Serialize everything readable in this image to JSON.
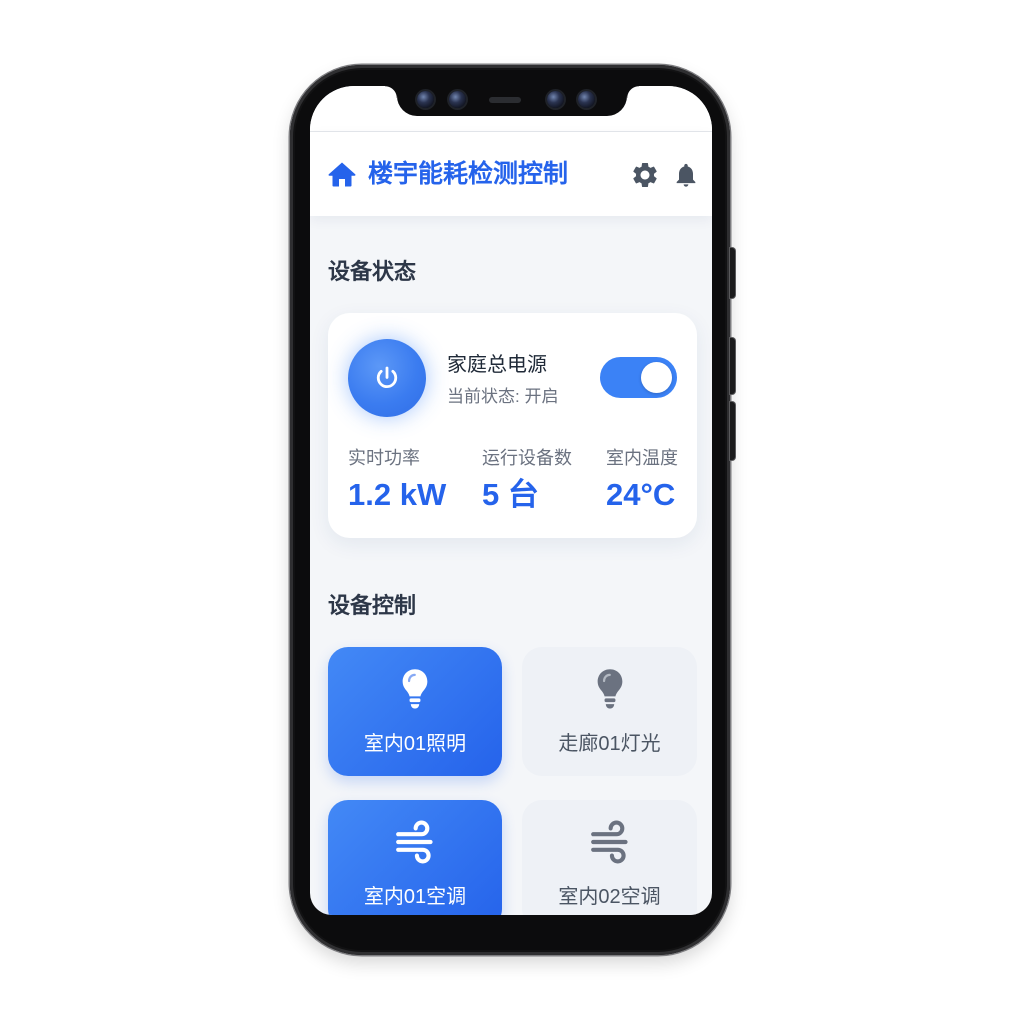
{
  "header": {
    "title": "楼宇能耗检测控制",
    "icons": {
      "brand": "home-icon",
      "settings": "gear-icon",
      "notifications": "bell-icon"
    }
  },
  "device_status": {
    "section_title": "设备状态",
    "main_power": {
      "name": "家庭总电源",
      "status_text": "当前状态: 开启",
      "is_on": true,
      "icon": "power-icon"
    },
    "stats": [
      {
        "label": "实时功率",
        "value": "1.2 kW"
      },
      {
        "label": "运行设备数",
        "value": "5 台"
      },
      {
        "label": "室内温度",
        "value": "24°C"
      }
    ]
  },
  "device_control": {
    "section_title": "设备控制",
    "devices": [
      {
        "name": "室内01照明",
        "icon": "lightbulb-icon",
        "active": true
      },
      {
        "name": "走廊01灯光",
        "icon": "lightbulb-icon",
        "active": false
      },
      {
        "name": "室内01空调",
        "icon": "wind-icon",
        "active": true
      },
      {
        "name": "室内02空调",
        "icon": "wind-icon",
        "active": false
      }
    ]
  },
  "colors": {
    "accent": "#2563eb",
    "toggle_on": "#3b82f6",
    "active_card_start": "#4389f6",
    "active_card_end": "#2563eb",
    "inactive_card": "#eef1f6",
    "page_background": "#f4f6f9",
    "muted_text": "#6b7280",
    "section_title": "#2d3748"
  }
}
